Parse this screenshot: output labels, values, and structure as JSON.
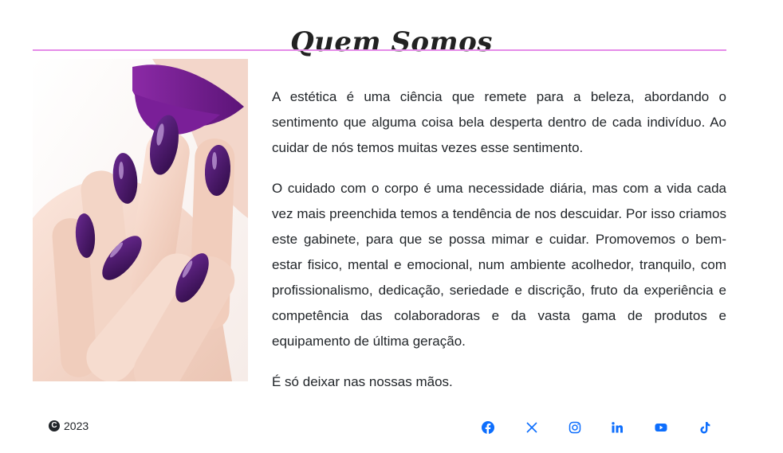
{
  "header": {
    "title": "Quem Somos"
  },
  "about": {
    "paragraphs": [
      "A estética é uma ciência que remete para a beleza, abordando o sentimento que alguma coisa bela desperta dentro de cada indivíduo. Ao cuidar de nós temos muitas vezes esse sentimento.",
      "O cuidado com o corpo é uma necessidade diária, mas com a vida cada vez mais preenchida temos a tendência de nos descuidar. Por isso criamos este gabinete, para que se possa mimar e cuidar. Promovemos o bem-estar fisico, mental e emocional, num ambiente acolhedor, tranquilo, com profissionalismo, dedicação, seriedade e discrição, fruto da experiência e competência das colaboradoras e da vasta gama de produtos e equipamento de última geração.",
      "É só deixar nas nossas mãos."
    ]
  },
  "footer": {
    "copyright_symbol": "C",
    "year": "2023",
    "social_icons": [
      "facebook-icon",
      "x-icon",
      "instagram-icon",
      "linkedin-icon",
      "youtube-icon",
      "tiktok-icon"
    ],
    "icon_color": "#0d6efd"
  },
  "colors": {
    "divider": "#e58be9",
    "nail_polish": "#4a1a6b"
  }
}
